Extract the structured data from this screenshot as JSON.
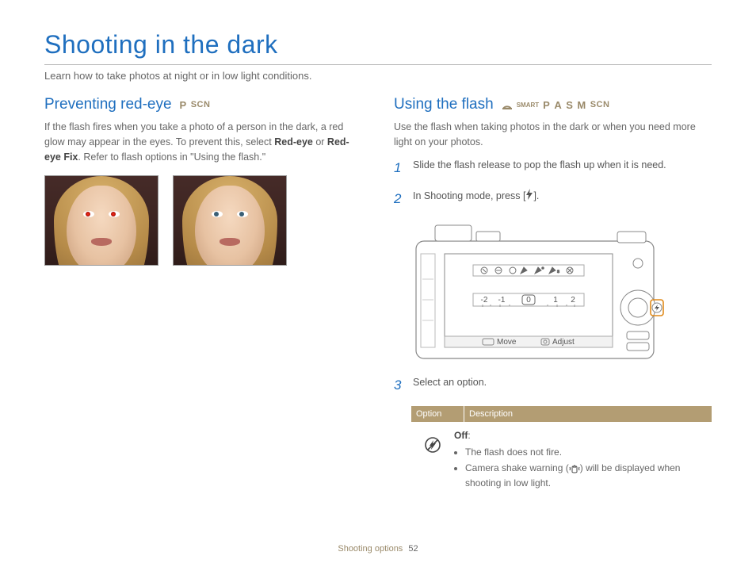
{
  "page": {
    "title": "Shooting in the dark",
    "lead": "Learn how to take photos at night or in low light conditions.",
    "footer_section": "Shooting options",
    "footer_page": "52"
  },
  "left": {
    "heading": "Preventing red-eye",
    "modes": {
      "p": "P",
      "scn": "SCN"
    },
    "body_pre": "If the flash fires when you take a photo of a person in the dark, a red glow may appear in the eyes. To prevent this, select ",
    "body_b1": "Red-eye",
    "body_mid": " or ",
    "body_b2": "Red-eye Fix",
    "body_post": ". Refer to flash options in \"Using the flash.\""
  },
  "right": {
    "heading": "Using the flash",
    "modes": {
      "smart": "SMART",
      "p": "P",
      "a": "A",
      "s": "S",
      "m": "M",
      "scn": "SCN"
    },
    "intro": "Use the flash when taking photos in the dark or when you need more light on your photos.",
    "steps": {
      "n1": "1",
      "t1": "Slide the flash release to pop the flash up when it is need.",
      "n2": "2",
      "t2a": "In Shooting mode, press [",
      "t2b": "].",
      "n3": "3",
      "t3": "Select an option."
    },
    "diagram": {
      "move": "Move",
      "adjust": "Adjust",
      "scale_center": "0",
      "scale_l1": "-1",
      "scale_l2": "-2",
      "scale_r1": "1",
      "scale_r2": "2"
    },
    "table": {
      "h1": "Option",
      "h2": "Description",
      "off_label": "Off",
      "off_colon": ":",
      "b1": "The flash does not fire.",
      "b2a": "Camera shake warning (",
      "b2b": ") will be displayed when shooting in low light."
    }
  }
}
